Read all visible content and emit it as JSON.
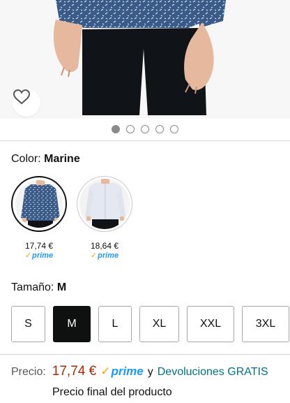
{
  "product_image": {
    "carousel_count": 5,
    "active_index": 0
  },
  "wishlist": {
    "icon": "heart-outline-icon"
  },
  "color": {
    "label": "Color:",
    "value": "Marine",
    "options": [
      {
        "name": "Marine",
        "price": "17,74 €",
        "prime": "prime",
        "selected": true
      },
      {
        "name": "White",
        "price": "18,64 €",
        "prime": "prime",
        "selected": false
      }
    ]
  },
  "size": {
    "label": "Tamaño:",
    "value": "M",
    "options": [
      "S",
      "M",
      "L",
      "XL",
      "XXL",
      "3XL"
    ],
    "selected": "M"
  },
  "buybox": {
    "price_label": "Precio:",
    "price": "17,74 €",
    "prime": "prime",
    "conjunction": "y",
    "returns": "Devoluciones GRATIS",
    "final_note": "Precio final del producto"
  },
  "colors": {
    "price_red": "#b12704",
    "prime_blue": "#1a98ff",
    "prime_check": "#f7a600",
    "link_teal": "#007185",
    "selected_size_bg": "#0f1111",
    "shirt_navy": "#2f4a73"
  }
}
